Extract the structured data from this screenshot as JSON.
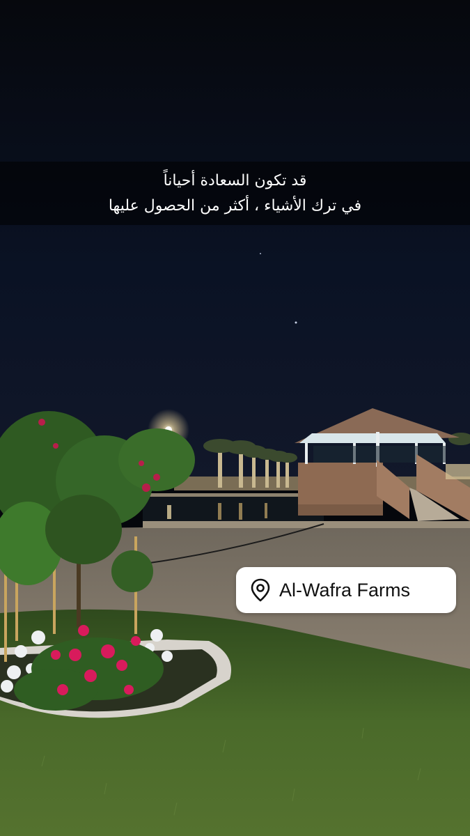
{
  "caption": {
    "line1": "قد تكون السعادة أحياناً",
    "line2": "في ترك الأشياء ، أكثر من الحصول عليها"
  },
  "location": {
    "label": "Al-Wafra Farms",
    "icon": "location-pin-icon"
  },
  "colors": {
    "sky": "#05070c",
    "caption_overlay": "#000000",
    "sticker_bg": "#ffffff",
    "sticker_text": "#111111",
    "grass": "#3f5a26",
    "flower_pink": "#d81b5c"
  }
}
